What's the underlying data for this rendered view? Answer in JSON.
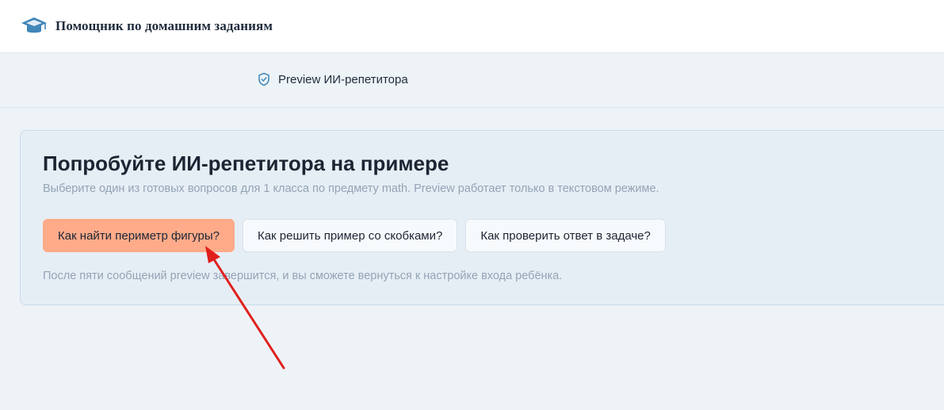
{
  "header": {
    "brand_title": "Помощник по домашним заданиям",
    "logo_icon": "graduation-cap-icon"
  },
  "subbar": {
    "badge_icon": "shield-check-icon",
    "badge_label": "Preview ИИ-репетитора"
  },
  "card": {
    "heading": "Попробуйте ИИ-репетитора на примере",
    "subtitle": "Выберите один из готовых вопросов для 1 класса по предмету math. Preview работает только в текстовом режиме.",
    "questions": [
      {
        "label": "Как найти периметр фигуры?",
        "active": true
      },
      {
        "label": "Как решить пример со скобками?",
        "active": false
      },
      {
        "label": "Как проверить ответ в задаче?",
        "active": false
      }
    ],
    "note": "После пяти сообщений preview завершится, и вы сможете вернуться к настройке входа ребёнка."
  },
  "colors": {
    "accent_active": "#ffab8a",
    "brand_icon": "#3f86b8",
    "annotation_arrow": "#e0201c"
  }
}
